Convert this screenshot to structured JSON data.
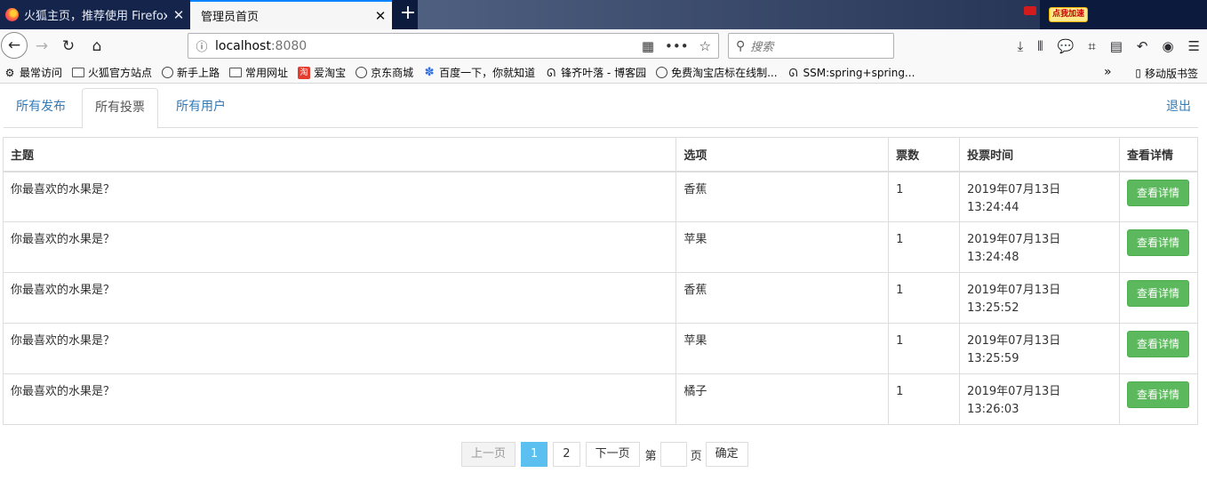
{
  "browser": {
    "tabs": [
      {
        "title": "火狐主页，推荐使用 Firefox 火",
        "close": "✕"
      },
      {
        "title": "管理员首页",
        "close": "✕"
      }
    ],
    "new_tab": "+",
    "promo": "点我加速",
    "url_host": "localhost",
    "url_port": ":8080",
    "search_placeholder": "搜索",
    "bookmarks": [
      {
        "label": "最常访问",
        "icon": "gear-icon"
      },
      {
        "label": "火狐官方站点",
        "icon": "folder-icon"
      },
      {
        "label": "新手上路",
        "icon": "globe-icon"
      },
      {
        "label": "常用网址",
        "icon": "folder-icon"
      },
      {
        "label": "爱淘宝",
        "icon": "taobao-icon"
      },
      {
        "label": "京东商城",
        "icon": "globe-icon"
      },
      {
        "label": "百度一下，你就知道",
        "icon": "baidu-icon"
      },
      {
        "label": "锋齐叶落 - 博客园",
        "icon": "blog-icon"
      },
      {
        "label": "免费淘宝店标在线制...",
        "icon": "globe-icon"
      },
      {
        "label": "SSM:spring+spring...",
        "icon": "blog-icon"
      }
    ],
    "mobile_bookmarks": "移动版书签"
  },
  "nav": {
    "tabs": [
      "所有发布",
      "所有投票",
      "所有用户"
    ],
    "active_tab": "所有投票",
    "logout": "退出"
  },
  "table": {
    "headers": [
      "主题",
      "选项",
      "票数",
      "投票时间",
      "查看详情"
    ],
    "rows": [
      {
        "topic": "你最喜欢的水果是？",
        "option": "香蕉",
        "count": "1",
        "date": "2019年07月13日",
        "time": "13:24:44",
        "action": "查看详情"
      },
      {
        "topic": "你最喜欢的水果是？",
        "option": "苹果",
        "count": "1",
        "date": "2019年07月13日",
        "time": "13:24:48",
        "action": "查看详情"
      },
      {
        "topic": "你最喜欢的水果是？",
        "option": "香蕉",
        "count": "1",
        "date": "2019年07月13日",
        "time": "13:25:52",
        "action": "查看详情"
      },
      {
        "topic": "你最喜欢的水果是？",
        "option": "苹果",
        "count": "1",
        "date": "2019年07月13日",
        "time": "13:25:59",
        "action": "查看详情"
      },
      {
        "topic": "你最喜欢的水果是？",
        "option": "橘子",
        "count": "1",
        "date": "2019年07月13日",
        "time": "13:26:03",
        "action": "查看详情"
      }
    ]
  },
  "pager": {
    "prev": "上一页",
    "pages": [
      "1",
      "2"
    ],
    "current": "1",
    "next": "下一页",
    "goto_prefix": "第",
    "goto_suffix": "页",
    "confirm": "确定"
  }
}
